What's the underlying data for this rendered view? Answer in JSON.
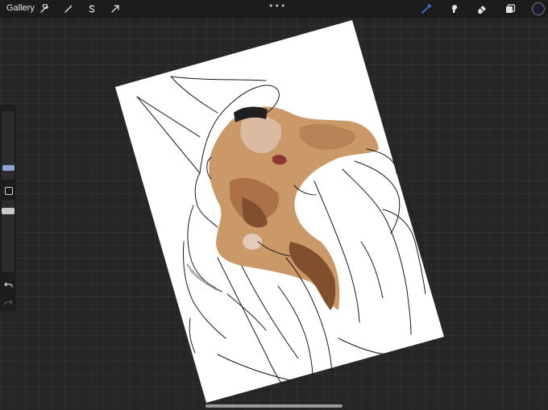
{
  "topbar": {
    "gallery_label": "Gallery",
    "more_menu": "•••",
    "left_tools": [
      "wrench-icon",
      "magic-wand-icon",
      "selection-icon",
      "transform-arrow-icon"
    ],
    "right_tools": [
      "brush-icon",
      "smudge-icon",
      "eraser-icon",
      "layers-icon"
    ],
    "active_tool": "brush-icon",
    "active_color": "#1f1a33",
    "accent_color": "#3b6fe0"
  },
  "sidebar": {
    "brush_size_fraction": 0.35,
    "opacity_fraction": 0.65,
    "buttons": [
      "modify-button",
      "undo-icon",
      "redo-icon"
    ]
  },
  "canvas": {
    "paper_color": "#ffffff",
    "skin_tones": [
      "#c9935f",
      "#a86a3e",
      "#7a4622",
      "#d9b79b"
    ]
  }
}
